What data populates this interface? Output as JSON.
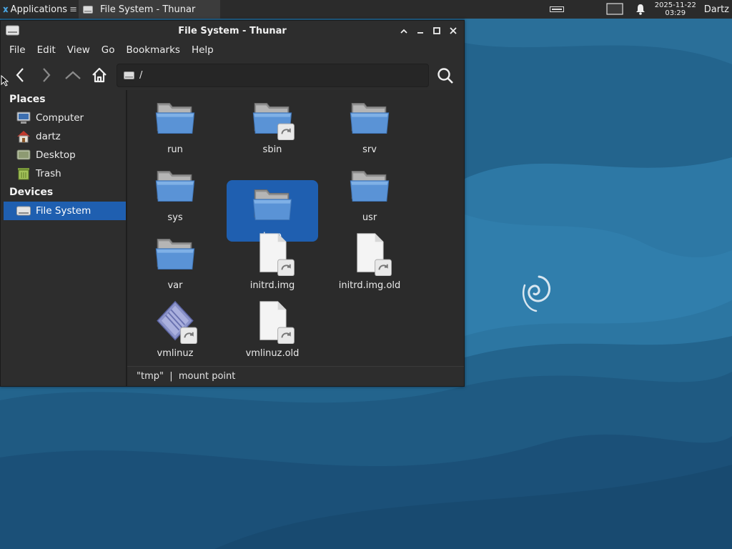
{
  "panel": {
    "applications_label": "Applications",
    "apps_icon": "xfce-mouse-icon",
    "task_title": "File System - Thunar",
    "clock_date": "2025-11-22",
    "clock_time": "03:29",
    "user": "Dartz"
  },
  "window": {
    "title": "File System - Thunar",
    "controls": [
      "minimize-up",
      "minimize",
      "maximize",
      "close"
    ]
  },
  "menubar": {
    "items": [
      "File",
      "Edit",
      "View",
      "Go",
      "Bookmarks",
      "Help"
    ]
  },
  "location": {
    "path": "/"
  },
  "sidebar": {
    "places_header": "Places",
    "places": [
      {
        "label": "Computer",
        "icon": "computer-icon"
      },
      {
        "label": "dartz",
        "icon": "home-icon"
      },
      {
        "label": "Desktop",
        "icon": "desktop-icon"
      },
      {
        "label": "Trash",
        "icon": "trash-icon"
      }
    ],
    "devices_header": "Devices",
    "devices": [
      {
        "label": "File System",
        "icon": "drive-icon",
        "selected": true
      }
    ]
  },
  "files": [
    {
      "name": "run",
      "type": "folder"
    },
    {
      "name": "sbin",
      "type": "folder-link"
    },
    {
      "name": "srv",
      "type": "folder"
    },
    {
      "name": "sys",
      "type": "folder"
    },
    {
      "name": "tmp",
      "type": "folder",
      "selected": true
    },
    {
      "name": "usr",
      "type": "folder"
    },
    {
      "name": "var",
      "type": "folder"
    },
    {
      "name": "initrd.img",
      "type": "file-link"
    },
    {
      "name": "initrd.img.old",
      "type": "file-link"
    },
    {
      "name": "vmlinuz",
      "type": "kernel-link"
    },
    {
      "name": "vmlinuz.old",
      "type": "file-link"
    }
  ],
  "statusbar": {
    "text": "\"tmp\"  |  mount point"
  },
  "colors": {
    "selection": "#1f5fb0",
    "panel": "#2b2b2b",
    "window": "#2d2d2d",
    "desktop": "#1f5f86"
  }
}
